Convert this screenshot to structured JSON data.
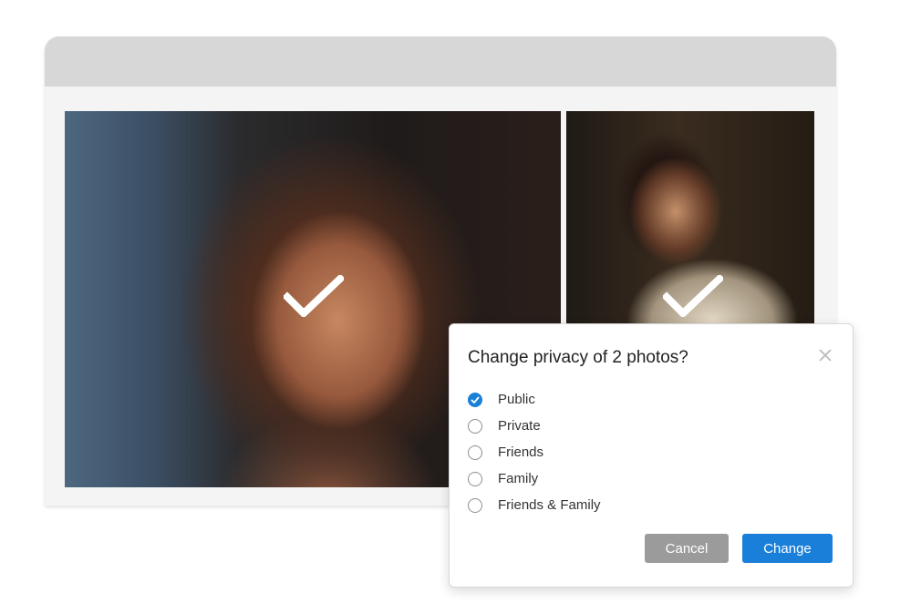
{
  "dialog": {
    "title": "Change privacy of 2 photos?",
    "options": [
      {
        "label": "Public",
        "checked": true
      },
      {
        "label": "Private",
        "checked": false
      },
      {
        "label": "Friends",
        "checked": false
      },
      {
        "label": "Family",
        "checked": false
      },
      {
        "label": "Friends & Family",
        "checked": false
      }
    ],
    "cancel_label": "Cancel",
    "change_label": "Change"
  },
  "photos": [
    {
      "selected": true,
      "icon": "checkmark-icon"
    },
    {
      "selected": true,
      "icon": "checkmark-icon"
    }
  ],
  "colors": {
    "accent": "#1a7fd8",
    "cancel": "#9b9b9b",
    "titlebar": "#d7d7d7"
  }
}
